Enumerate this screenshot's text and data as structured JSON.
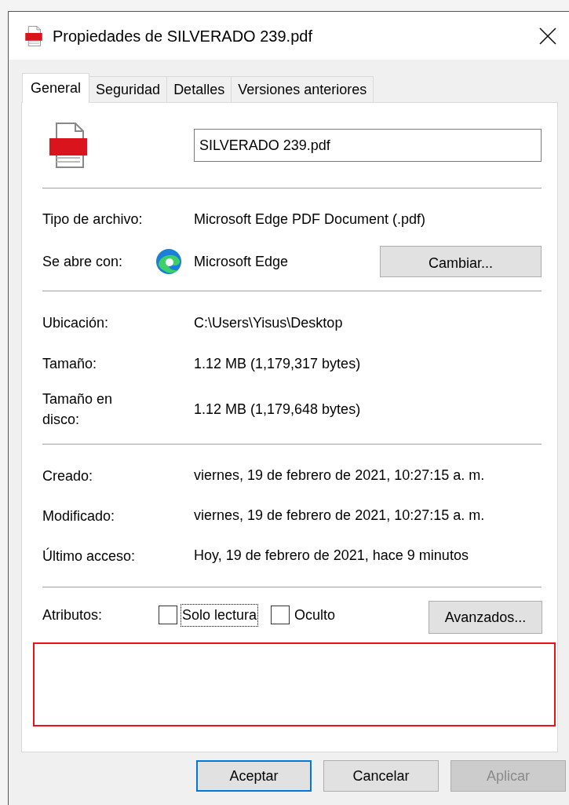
{
  "window": {
    "title": "Propiedades de SILVERADO 239.pdf"
  },
  "tabs": [
    {
      "label": "General",
      "selected": true
    },
    {
      "label": "Seguridad",
      "selected": false
    },
    {
      "label": "Detalles",
      "selected": false
    },
    {
      "label": "Versiones anteriores",
      "selected": false
    }
  ],
  "file_name": "SILVERADO 239.pdf",
  "file_type": {
    "label": "Tipo de archivo:",
    "value": "Microsoft Edge PDF Document (.pdf)"
  },
  "opens_with": {
    "label": "Se abre con:",
    "app": "Microsoft Edge",
    "button": "Cambiar..."
  },
  "location_rows": [
    {
      "label": "Ubicación:",
      "value": "C:\\Users\\Yisus\\Desktop"
    },
    {
      "label": "Tamaño:",
      "value": "1.12 MB (1,179,317 bytes)"
    },
    {
      "label": "Tamaño en disco:",
      "value": "1.12 MB (1,179,648 bytes)"
    }
  ],
  "date_rows": [
    {
      "label": "Creado:",
      "value": "viernes, 19 de febrero de 2021, 10:27:15 a. m."
    },
    {
      "label": "Modificado:",
      "value": "viernes, 19 de febrero de 2021, 10:27:15 a. m."
    },
    {
      "label": "Último acceso:",
      "value": "Hoy, 19 de febrero de 2021, hace 9 minutos"
    }
  ],
  "attributes": {
    "label": "Atributos:",
    "options": [
      {
        "label": "Solo lectura",
        "checked": false,
        "focused": true
      },
      {
        "label": "Oculto",
        "checked": false,
        "focused": false
      }
    ],
    "button": "Avanzados..."
  },
  "buttons": [
    {
      "label": "Aceptar",
      "default": true,
      "disabled": false
    },
    {
      "label": "Cancelar",
      "default": false,
      "disabled": false
    },
    {
      "label": "Aplicar",
      "default": false,
      "disabled": true
    }
  ]
}
